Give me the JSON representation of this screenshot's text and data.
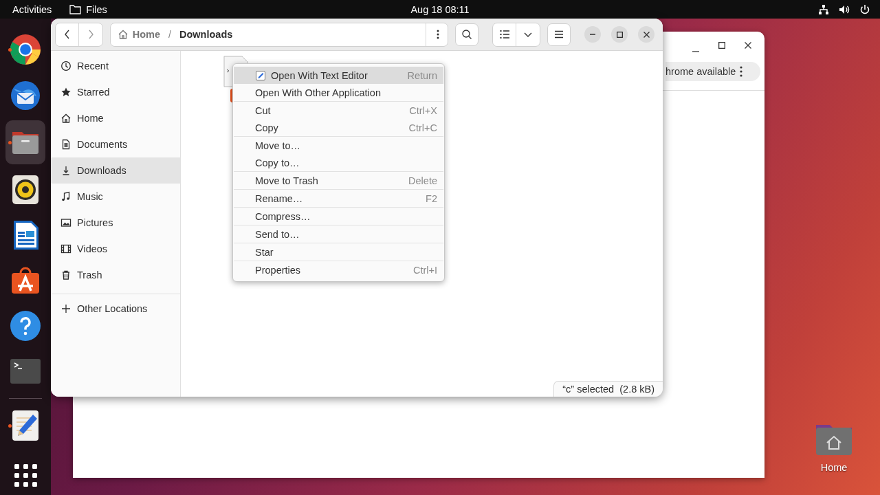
{
  "topbar": {
    "activities": "Activities",
    "app": "Files",
    "clock": "Aug 18  08:11"
  },
  "dock": {
    "pinned": [
      {
        "kind": "chrome",
        "running": true,
        "selected": false
      },
      {
        "kind": "thunderbird",
        "running": false,
        "selected": false
      },
      {
        "kind": "files",
        "running": true,
        "selected": true
      },
      {
        "kind": "rhythmbox",
        "running": false,
        "selected": false
      },
      {
        "kind": "writer",
        "running": false,
        "selected": false
      },
      {
        "kind": "appcenter",
        "running": false,
        "selected": false
      },
      {
        "kind": "help",
        "running": false,
        "selected": false
      },
      {
        "kind": "terminal",
        "running": false,
        "selected": false
      }
    ],
    "others": [
      {
        "kind": "texteditor",
        "running": true,
        "selected": false
      }
    ]
  },
  "back_window": {
    "notice": "hrome available"
  },
  "files_window": {
    "path": [
      {
        "label": "Home"
      },
      {
        "label": "Downloads"
      }
    ],
    "sidebar": [
      {
        "kind": "recent",
        "label": "Recent",
        "selected": false
      },
      {
        "kind": "starred",
        "label": "Starred",
        "selected": false
      },
      {
        "kind": "home",
        "label": "Home",
        "selected": false
      },
      {
        "kind": "documents",
        "label": "Documents",
        "selected": false
      },
      {
        "kind": "downloads",
        "label": "Downloads",
        "selected": true
      },
      {
        "kind": "music",
        "label": "Music",
        "selected": false
      },
      {
        "kind": "pictures",
        "label": "Pictures",
        "selected": false
      },
      {
        "kind": "videos",
        "label": "Videos",
        "selected": false
      },
      {
        "kind": "trash",
        "label": "Trash",
        "selected": false
      }
    ],
    "path_separator": "/",
    "other_locations": "Other Locations",
    "status": "“c” selected  (2.8 kB)"
  },
  "context_menu": [
    [
      {
        "label": "Open With Text Editor",
        "shortcut": "Return",
        "kind": "app",
        "selected": true
      },
      {
        "label": "Open With Other Application",
        "kind": "plain",
        "selected": false
      }
    ],
    [
      {
        "label": "Cut",
        "shortcut": "Ctrl+X",
        "kind": "plain",
        "selected": false
      },
      {
        "label": "Copy",
        "shortcut": "Ctrl+C",
        "kind": "plain",
        "selected": false
      }
    ],
    [
      {
        "label": "Move to…",
        "kind": "plain",
        "selected": false
      },
      {
        "label": "Copy to…",
        "kind": "plain",
        "selected": false
      }
    ],
    [
      {
        "label": "Move to Trash",
        "shortcut": "Delete",
        "kind": "plain",
        "selected": false
      }
    ],
    [
      {
        "label": "Rename…",
        "shortcut": "F2",
        "kind": "plain",
        "selected": false
      }
    ],
    [
      {
        "label": "Compress…",
        "kind": "plain",
        "selected": false
      }
    ],
    [
      {
        "label": "Send to…",
        "kind": "plain",
        "selected": false
      }
    ],
    [
      {
        "label": "Star",
        "kind": "plain",
        "selected": false
      }
    ],
    [
      {
        "label": "Properties",
        "shortcut": "Ctrl+I",
        "kind": "plain",
        "selected": false
      }
    ]
  ],
  "desktop_icons": [
    {
      "label": "Home"
    }
  ]
}
